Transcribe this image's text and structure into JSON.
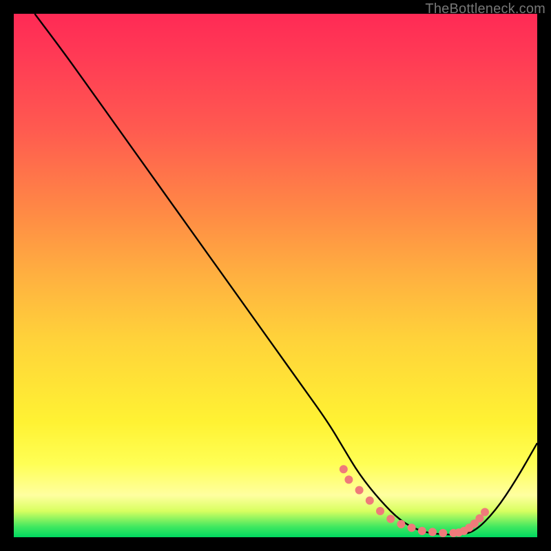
{
  "watermark": "TheBottleneck.com",
  "chart_data": {
    "type": "line",
    "title": "",
    "xlabel": "",
    "ylabel": "",
    "xlim": [
      0,
      100
    ],
    "ylim": [
      0,
      100
    ],
    "series": [
      {
        "name": "bottleneck-curve",
        "color": "#000000",
        "x": [
          4,
          10,
          15,
          20,
          25,
          30,
          35,
          40,
          45,
          50,
          55,
          60,
          63,
          66,
          70,
          74,
          78,
          82,
          85,
          88,
          92,
          96,
          100
        ],
        "values": [
          100,
          92,
          85,
          78,
          71,
          64,
          57,
          50,
          43,
          36,
          29,
          22,
          17,
          12,
          7,
          3,
          1,
          0.5,
          0.5,
          1,
          5,
          11,
          18
        ]
      },
      {
        "name": "optimal-range-markers",
        "color": "#ef7a7a",
        "type": "scatter",
        "x": [
          63,
          64,
          66,
          68,
          70,
          72,
          74,
          76,
          78,
          80,
          82,
          84,
          85,
          86,
          87,
          88,
          89,
          90
        ],
        "values": [
          13,
          11,
          9,
          7,
          5,
          3.5,
          2.5,
          1.8,
          1.2,
          1,
          0.8,
          0.8,
          0.9,
          1.2,
          1.8,
          2.6,
          3.6,
          4.8
        ]
      }
    ],
    "gradient_stops": [
      {
        "pos": 0,
        "color": "#ff2a55"
      },
      {
        "pos": 22,
        "color": "#ff5a50"
      },
      {
        "pos": 50,
        "color": "#ffb040"
      },
      {
        "pos": 78,
        "color": "#fff233"
      },
      {
        "pos": 95,
        "color": "#d8ff60"
      },
      {
        "pos": 100,
        "color": "#00d860"
      }
    ]
  }
}
